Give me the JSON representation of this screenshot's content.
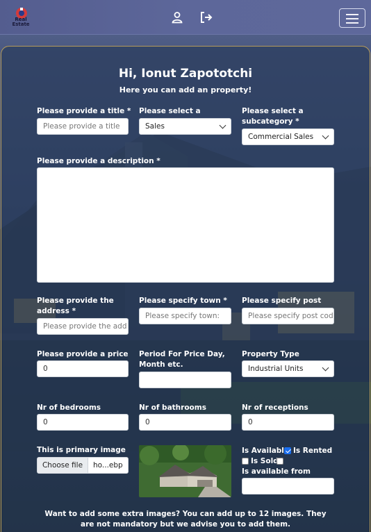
{
  "brand": {
    "logo_text": "Real Estate"
  },
  "header": {
    "greeting": "Hi, Ionut Zapototchi",
    "subtitle": "Here you can add an property!"
  },
  "form": {
    "title": {
      "label": "Please provide a title *",
      "placeholder": "Please provide a title"
    },
    "category": {
      "label": "Please select a category *",
      "value": "Sales"
    },
    "subcategory": {
      "label": "Please select a subcategory *",
      "value": "Commercial Sales"
    },
    "description": {
      "label": "Please provide a description *"
    },
    "address": {
      "label": "Please provide the address *",
      "placeholder": "Please provide the add"
    },
    "town": {
      "label": "Please specify town *",
      "placeholder": "Please specify town:"
    },
    "postcode": {
      "label": "Please specify post code *",
      "placeholder": "Please specify post cod"
    },
    "price": {
      "label": "Please provide a price *",
      "value": "0"
    },
    "period": {
      "label": "Period For Price Day, Month etc.",
      "value": ""
    },
    "property_type": {
      "label": "Property Type",
      "value": "Industrial Units"
    },
    "bedrooms": {
      "label": "Nr of bedrooms",
      "value": "0"
    },
    "bathrooms": {
      "label": "Nr of bathrooms",
      "value": "0"
    },
    "receptions": {
      "label": "Nr of receptions",
      "value": "0"
    },
    "primary_image": {
      "label": "This is primary image",
      "button": "Choose file",
      "filename": "ho...ebp"
    },
    "is_available": {
      "label": "Is Available",
      "checked": true
    },
    "is_rented": {
      "label": "Is Rented",
      "checked": false
    },
    "is_sold": {
      "label": "Is Sold",
      "checked": false
    },
    "available_from": {
      "label": "Is available from",
      "value": ""
    }
  },
  "footer": {
    "text": "Want to add some extra images? You can add up to 12 images. They are not mandatory but we advise you to add them."
  },
  "colors": {
    "accent": "#1a6ff0",
    "panel_border": "#b79c5a"
  }
}
